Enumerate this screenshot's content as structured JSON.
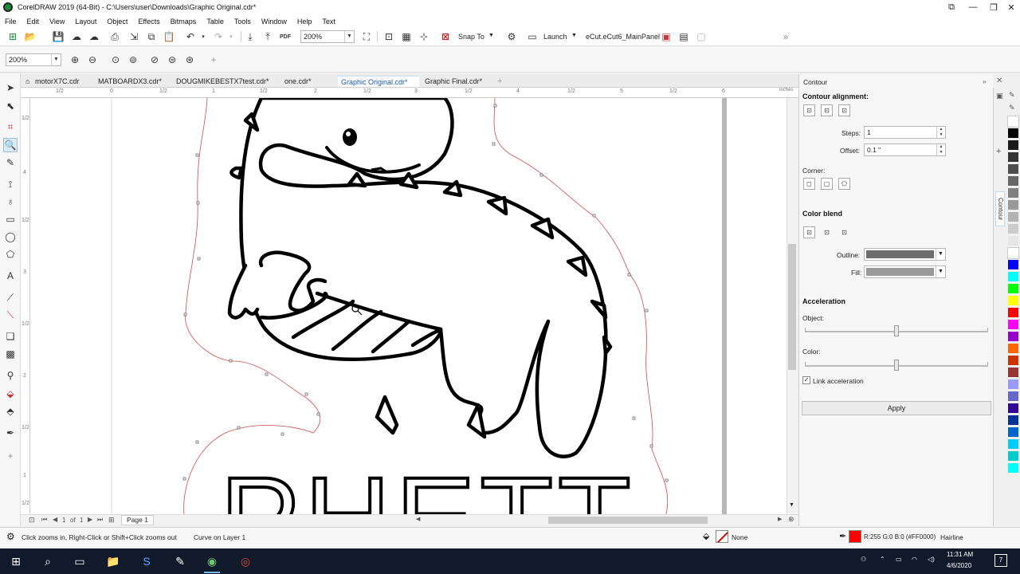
{
  "window": {
    "title": "CorelDRAW 2019 (64-Bit) - C:\\Users\\user\\Downloads\\Graphic Original.cdr*"
  },
  "menu": [
    "File",
    "Edit",
    "View",
    "Layout",
    "Object",
    "Effects",
    "Bitmaps",
    "Table",
    "Tools",
    "Window",
    "Help",
    "Text"
  ],
  "toolbar": {
    "zoom_value": "200%",
    "pdf_label": "PDF",
    "snap_to_label": "Snap To",
    "launch_label": "Launch",
    "panel_label": "eCut.eCut6_MainPanel"
  },
  "propbar": {
    "zoom_value": "200%"
  },
  "tabs": [
    {
      "label": "motorX7C.cdr"
    },
    {
      "label": "MATBOARDX3.cdr*"
    },
    {
      "label": "DOUGMIKEBESTX7test.cdr*"
    },
    {
      "label": "one.cdr*"
    },
    {
      "label": "Graphic Original.cdr*",
      "active": true
    },
    {
      "label": "Graphic Final.cdr*"
    }
  ],
  "ruler": {
    "unit": "inches",
    "top_labels": [
      "1/2",
      "0",
      "1/2",
      "1",
      "1/2",
      "2",
      "1/2",
      "3",
      "1/2",
      "4",
      "1/2",
      "5",
      "1/2",
      "6"
    ],
    "left_labels": [
      "1/2",
      "4",
      "1/2",
      "3",
      "1/2",
      "2",
      "1/2",
      "1",
      "1/2"
    ]
  },
  "canvas": {
    "artwork_text": "PHETT"
  },
  "page_nav": {
    "current": "1",
    "of_label": "of",
    "total": "1",
    "page_tab": "Page 1"
  },
  "docker": {
    "title": "Contour",
    "alignment_label": "Contour alignment:",
    "steps_label": "Steps:",
    "steps_value": "1",
    "offset_label": "Offset:",
    "offset_value": "0.1 \"",
    "corner_label": "Corner:",
    "color_blend_label": "Color blend",
    "outline_label": "Outline:",
    "outline_color": "#6e6e6e",
    "fill_label": "Fill:",
    "fill_color": "#9a9a9a",
    "acceleration_label": "Acceleration",
    "object_label": "Object:",
    "color_label": "Color:",
    "link_accel_label": "Link acceleration",
    "link_accel_checked": true,
    "apply_label": "Apply",
    "side_tab_label": "Contour"
  },
  "palette": [
    "#ffffff",
    "#000000",
    "#1a1a1a",
    "#333333",
    "#4d4d4d",
    "#666666",
    "#808080",
    "#999999",
    "#b3b3b3",
    "#cccccc",
    "#e6e6e6",
    "#ffffff",
    "#0000ff",
    "#00ffff",
    "#00ff00",
    "#ffff00",
    "#ff0000",
    "#ff00ff",
    "#9900cc",
    "#ff6600",
    "#cc3300",
    "#993333",
    "#9999ff",
    "#6666cc",
    "#330099",
    "#003399",
    "#0066cc",
    "#00ccff",
    "#00cccc",
    "#00ffff"
  ],
  "status": {
    "hint": "Click zooms in, Right-Click or Shift+Click zooms out",
    "object_info": "Curve on Layer 1",
    "fill_value": "None",
    "outline_color_value": "R:255 G:0 B:0 (#FF0000)",
    "outline_width": "Hairline",
    "outline_swatch": "#ff0000"
  },
  "taskbar": {
    "time": "11:31 AM",
    "date": "4/6/2020",
    "notifications": "7"
  }
}
